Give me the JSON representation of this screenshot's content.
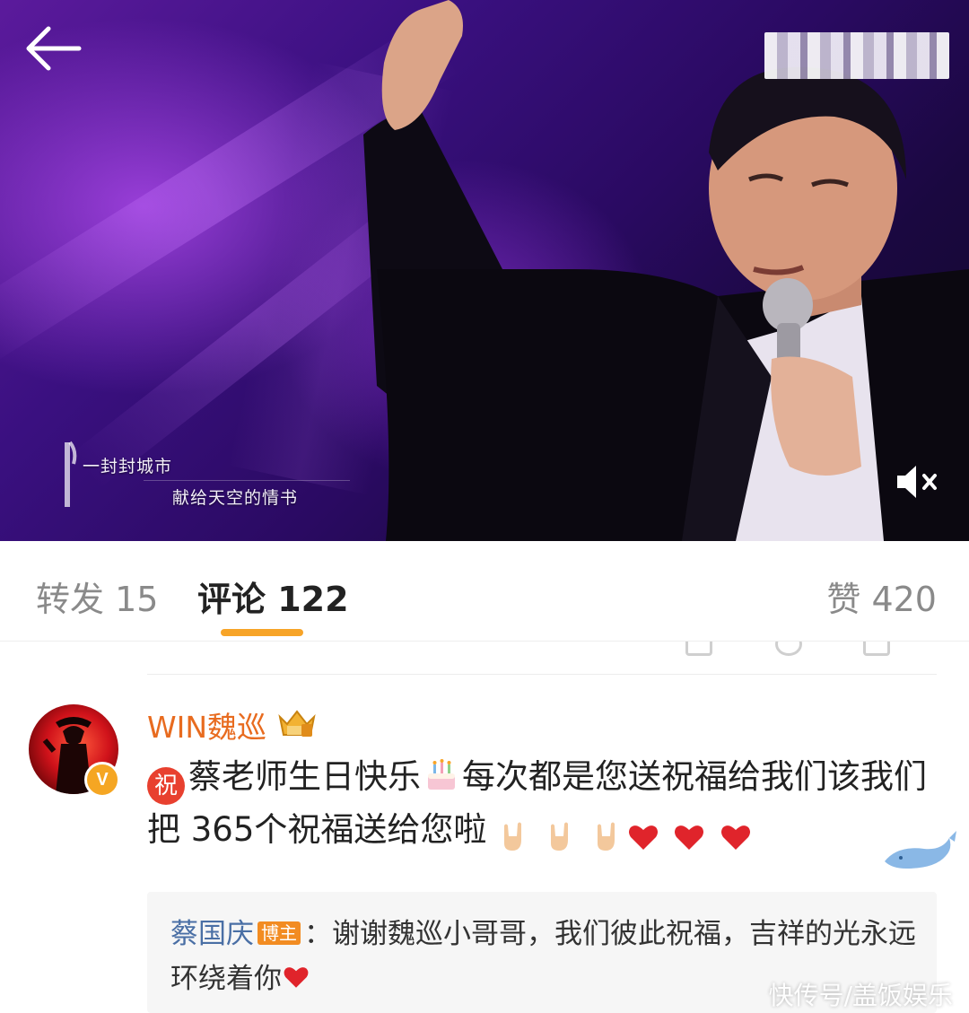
{
  "video": {
    "lyric_line_1": "一封封城市",
    "lyric_line_2": "献给天空的情书"
  },
  "tabs": {
    "repost": "转发 15",
    "comment": "评论 122",
    "like": "赞 420"
  },
  "comment": {
    "username": "WIN魏巡",
    "zhu_label": "祝",
    "text_part_1": "蔡老师生日快乐",
    "text_part_2": "每次都是您送祝福给我们该我们把 365个祝福送给您啦",
    "verified_label": "V",
    "reply": {
      "author": "蔡国庆",
      "badge": "博主",
      "text": "：谢谢魏巡小哥哥，我们彼此祝福，吉祥的光永远环绕着你"
    }
  },
  "watermark": "快传号/盖饭娱乐",
  "colors": {
    "accent": "#f7a428",
    "username": "#e86b1f",
    "reply_name": "#4a6fa5",
    "heart": "#e0242b"
  },
  "icons": [
    "back-arrow-icon",
    "mute-icon",
    "crown-badge-icon",
    "verified-badge-icon",
    "cake-icon",
    "rock-hand-icon",
    "heart-icon",
    "whale-icon"
  ]
}
